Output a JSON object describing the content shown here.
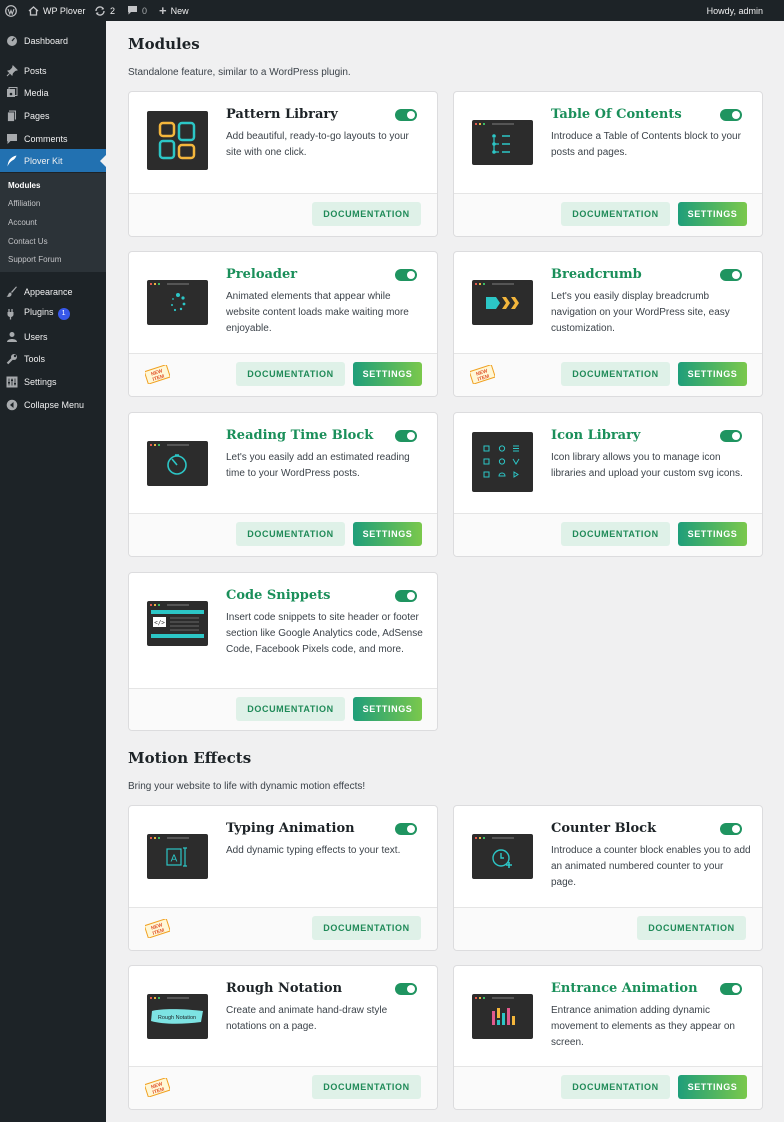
{
  "adminbar": {
    "site_name": "WP Plover",
    "updates_count": "2",
    "comments_count": "0",
    "new_label": "New",
    "greeting": "Howdy, admin"
  },
  "sidebar": {
    "dashboard": "Dashboard",
    "posts": "Posts",
    "media": "Media",
    "pages": "Pages",
    "comments": "Comments",
    "plover_kit": "Plover Kit",
    "submenu": [
      "Modules",
      "Affiliation",
      "Account",
      "Contact Us",
      "Support Forum"
    ],
    "appearance": "Appearance",
    "plugins": "Plugins",
    "plugins_badge": "1",
    "users": "Users",
    "tools": "Tools",
    "settings": "Settings",
    "collapse": "Collapse Menu"
  },
  "labels": {
    "documentation": "DOCUMENTATION",
    "settings": "SETTINGS",
    "new_badge_top": "NEW",
    "new_badge_bottom": "ITEM"
  },
  "colors": {
    "accent_green": "#1f9460",
    "admin_blue": "#2271b1",
    "card_title_green": "#1a8f5a"
  },
  "modules": {
    "title": "Modules",
    "description": "Standalone feature, similar to a WordPress plugin.",
    "cards": [
      {
        "title": "Pattern Library",
        "description": "Add beautiful, ready-to-go layouts to your site with one click.",
        "enabled": true,
        "icon": "pattern-grid-icon"
      },
      {
        "title": "Table Of Contents",
        "description": "Introduce a Table of Contents block to your posts and pages.",
        "enabled": true,
        "icon": "table-of-contents-icon"
      },
      {
        "title": "Preloader",
        "description": "Animated elements that appear while website content loads make waiting more enjoyable.",
        "enabled": true,
        "icon": "spinner-icon",
        "new": true
      },
      {
        "title": "Breadcrumb",
        "description": "Let's you easily display breadcrumb navigation on your WordPress site, easy customization.",
        "enabled": true,
        "icon": "breadcrumb-arrows-icon",
        "new": true
      },
      {
        "title": "Reading Time Block",
        "description": "Let's you easily add an estimated reading time to your WordPress posts.",
        "enabled": true,
        "icon": "timer-icon"
      },
      {
        "title": "Icon Library",
        "description": "Icon library allows you to manage icon libraries and upload your custom svg icons.",
        "enabled": true,
        "icon": "icon-grid-icon"
      },
      {
        "title": "Code Snippets",
        "description": "Insert code snippets to site header or footer section like Google Analytics code, AdSense Code, Facebook Pixels code, and more.",
        "enabled": true,
        "icon": "code-snippet-icon"
      }
    ]
  },
  "motion": {
    "title": "Motion Effects",
    "description": "Bring your website to life with dynamic motion effects!",
    "cards": [
      {
        "title": "Typing Animation",
        "description": "Add dynamic typing effects to your text.",
        "enabled": true,
        "icon": "typing-cursor-icon",
        "new": true
      },
      {
        "title": "Counter Block",
        "description": "Introduce a counter block enables you to add an animated numbered counter to your page.",
        "enabled": true,
        "icon": "counter-clock-icon"
      },
      {
        "title": "Rough Notation",
        "description": "Create and animate hand-draw style notations on a page.",
        "enabled": true,
        "icon": "rough-notation-icon",
        "thumb_text": "Rough Notation",
        "new": true
      },
      {
        "title": "Entrance Animation",
        "description": "Entrance animation adding dynamic movement to elements as they appear on screen.",
        "enabled": true,
        "icon": "entrance-bars-icon"
      }
    ]
  }
}
